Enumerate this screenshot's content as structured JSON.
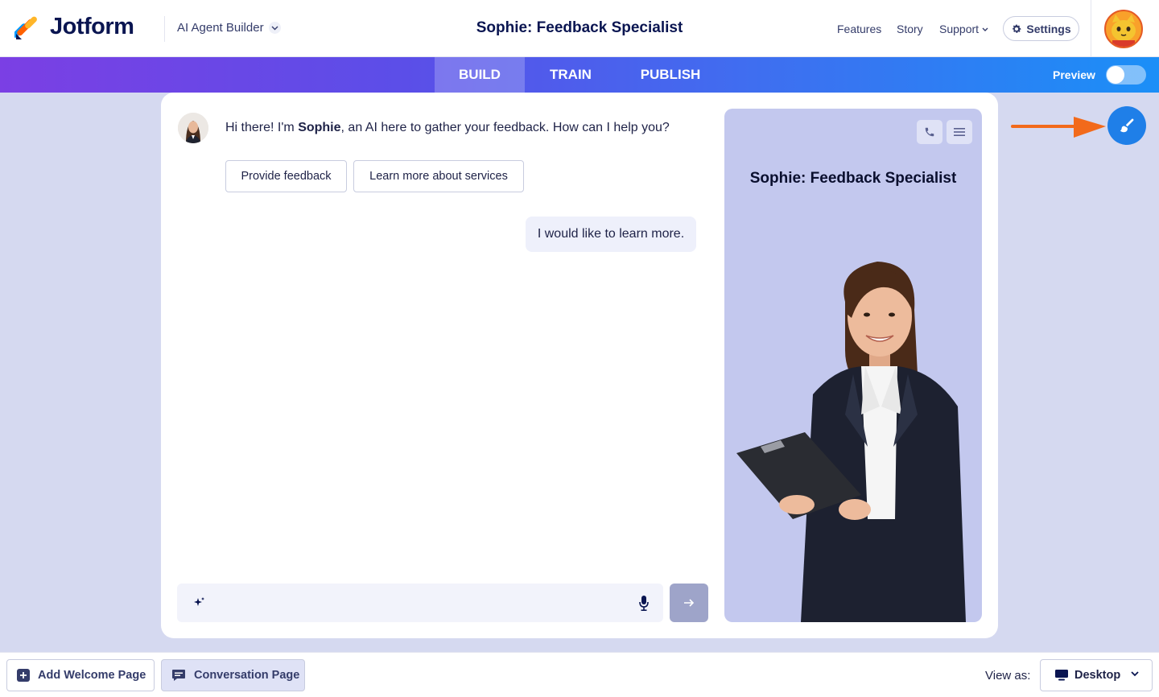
{
  "header": {
    "brand": "Jotform",
    "product": "AI Agent Builder",
    "title": "Sophie: Feedback Specialist",
    "nav": [
      "Features",
      "Story",
      "Support"
    ],
    "settings_label": "Settings"
  },
  "tabs": [
    {
      "label": "BUILD",
      "active": true
    },
    {
      "label": "TRAIN",
      "active": false
    },
    {
      "label": "PUBLISH",
      "active": false
    }
  ],
  "preview": {
    "label": "Preview",
    "enabled": false
  },
  "chat": {
    "bot_greeting_pre": "Hi there! I'm ",
    "bot_name": "Sophie",
    "bot_greeting_post": ", an AI here to gather your feedback. How can I help you?",
    "suggestions": [
      "Provide feedback",
      "Learn more about services"
    ],
    "user_message": "I would like to learn more.",
    "input_placeholder": ""
  },
  "agent_preview": {
    "title": "Sophie: Feedback Specialist"
  },
  "footer": {
    "add_welcome": "Add Welcome Page",
    "conversation": "Conversation Page",
    "view_as_label": "View as:",
    "device": "Desktop"
  },
  "colors": {
    "accent_blue": "#1f7fe8",
    "arrow_orange": "#f26a1b",
    "panel_bg": "#c3c8ee",
    "canvas_bg": "#d5d9f0"
  }
}
